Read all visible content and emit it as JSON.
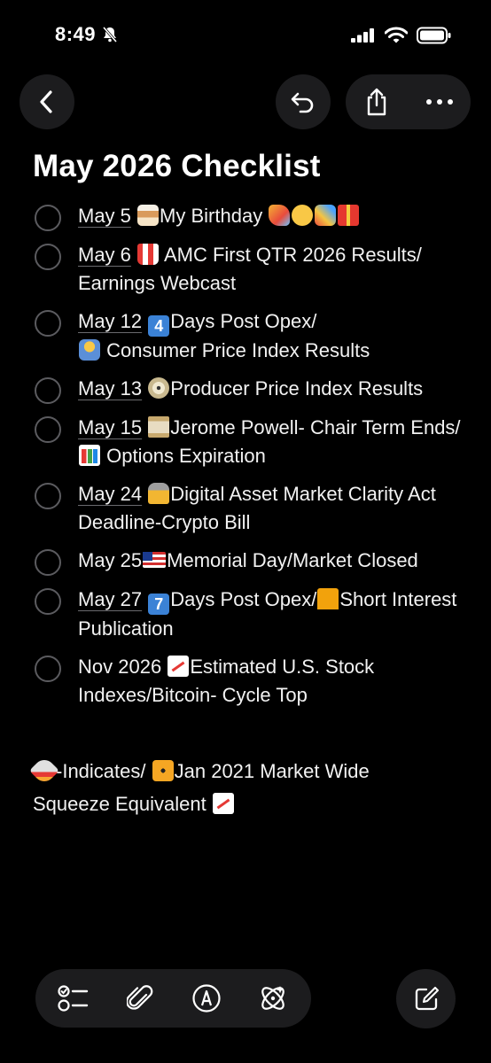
{
  "status_bar": {
    "time": "8:49",
    "icons": [
      "bell-slash-icon",
      "cellular-signal-icon",
      "wifi-icon",
      "battery-icon"
    ]
  },
  "navigation": {
    "icons": [
      "chevron-left-icon",
      "undo-icon",
      "share-icon",
      "ellipsis-icon"
    ]
  },
  "note": {
    "title": "May 2026 Checklist",
    "items": [
      {
        "date": "May 5",
        "text": "My Birthday",
        "checked": false
      },
      {
        "date": "May 6",
        "text": "AMC First QTR 2026 Results/ Earnings Webcast",
        "checked": false
      },
      {
        "date": "May 12",
        "text_a": "Days Post Opex/",
        "text_b": "Consumer Price Index Results",
        "checked": false
      },
      {
        "date": "May 13",
        "text": "Producer Price Index Results",
        "checked": false
      },
      {
        "date": "May 15",
        "text_a": "Jerome Powell- Chair Term Ends/",
        "text_b": "Options Expiration",
        "checked": false
      },
      {
        "date": "May 24",
        "text": "Digital Asset Market Clarity Act Deadline-Crypto Bill",
        "checked": false
      },
      {
        "date": "May 25",
        "text": "Memorial Day/Market Closed",
        "checked": false
      },
      {
        "date": "May 27",
        "text_a": "Days Post Opex/",
        "text_b": "Short Interest Publication",
        "checked": false
      },
      {
        "date": "Nov 2026",
        "text": "Estimated U.S. Stock Indexes/Bitcoin- Cycle Top",
        "checked": false
      }
    ],
    "keycaps": {
      "four": "4",
      "seven": "7"
    },
    "footer": {
      "text_a": "-Indicates/",
      "text_b": "Jan 2021 Market Wide Squeeze Equivalent"
    }
  },
  "toolbar": {
    "icons": [
      "checklist-icon",
      "paperclip-icon",
      "markup-icon",
      "writing-tools-icon",
      "compose-icon"
    ]
  },
  "colors": {
    "background": "#000000",
    "text": "#f2f2f2",
    "button_background": "#1c1c1e",
    "checkbox_border": "#5b5b5f"
  }
}
